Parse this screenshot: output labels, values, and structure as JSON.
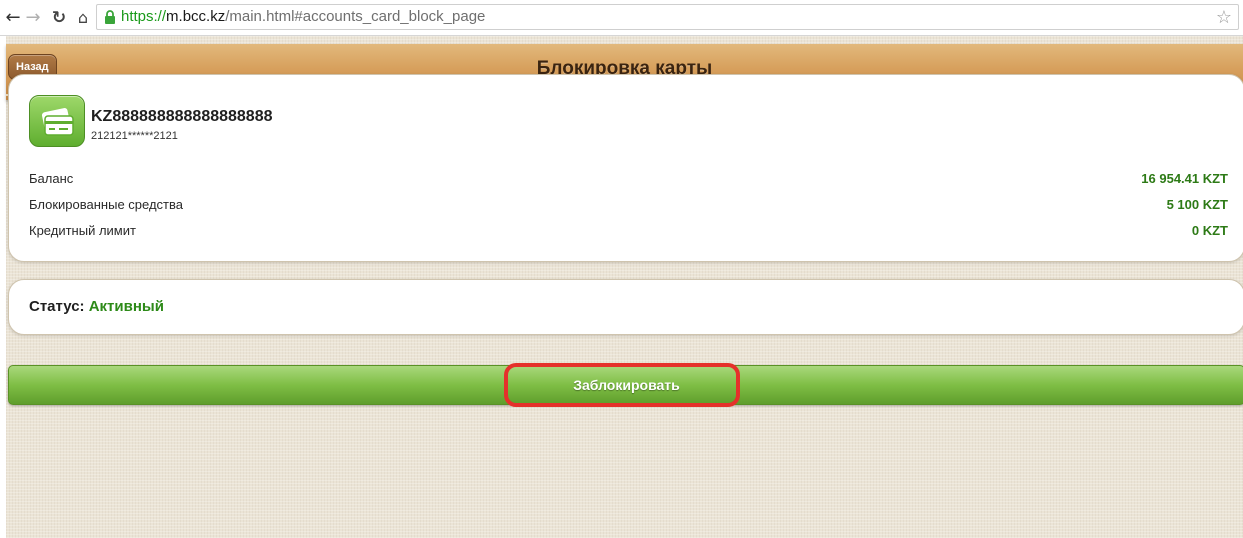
{
  "browser": {
    "url_scheme": "https://",
    "url_host": "m.bcc.kz",
    "url_path": "/main.html#accounts_card_block_page"
  },
  "header": {
    "back_label": "Назад",
    "title": "Блокировка карты"
  },
  "account": {
    "number": "KZ888888888888888888",
    "card_mask": "212121******2121",
    "rows": [
      {
        "label": "Баланс",
        "value": "16 954.41 KZT"
      },
      {
        "label": "Блокированные средства",
        "value": "5 100 KZT"
      },
      {
        "label": "Кредитный лимит",
        "value": "0 KZT"
      }
    ]
  },
  "status": {
    "label": "Статус:",
    "value": "Активный"
  },
  "actions": {
    "block_label": "Заблокировать"
  },
  "colors": {
    "header_brown": "#d79f5c",
    "accent_green": "#2d7a16",
    "button_green": "#7fbe45",
    "highlight_red": "#e5312b"
  }
}
